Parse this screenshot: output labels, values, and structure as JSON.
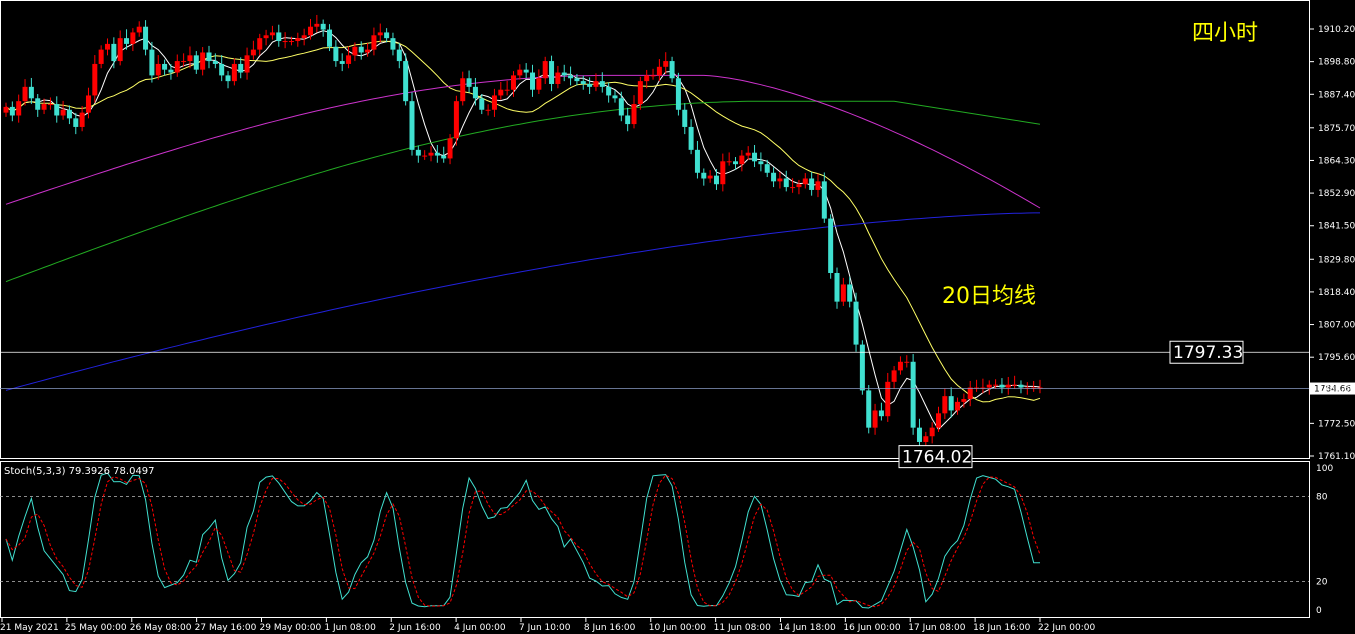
{
  "chart_data": {
    "type": "candlestick",
    "period_label": "四小时",
    "annotation": "20日均线",
    "price_axis": {
      "ticks": [
        "1910.20",
        "1898.80",
        "1887.40",
        "1875.70",
        "1864.30",
        "1852.90",
        "1841.50",
        "1829.80",
        "1818.40",
        "1807.00",
        "1795.60",
        "1784.66",
        "1772.50",
        "1761.10"
      ],
      "range": [
        1761.1,
        1910.2
      ]
    },
    "levels": {
      "resistance": {
        "label": "1797.33",
        "value": 1797.33,
        "color": "#ffffff"
      },
      "current": {
        "label": "1784.66",
        "value": 1784.66,
        "color": "#8a9bc4"
      },
      "low": {
        "label": "1764.02",
        "value": 1764.02,
        "color": "#ffffff"
      }
    },
    "x_axis": {
      "ticks": [
        "21 May 2021",
        "25 May 00:00",
        "26 May 08:00",
        "27 May 16:00",
        "29 May 00:00",
        "1 Jun 08:00",
        "2 Jun 16:00",
        "4 Jun 00:00",
        "7 Jun 10:00",
        "8 Jun 16:00",
        "10 Jun 00:00",
        "11 Jun 08:00",
        "14 Jun 18:00",
        "16 Jun 00:00",
        "17 Jun 08:00",
        "18 Jun 16:00",
        "22 Jun 00:00"
      ]
    },
    "colors": {
      "up": "#ff0000",
      "down": "#40e0d0",
      "ma5": "#ffffff",
      "ma20": "#ffff66",
      "ma60": "#22aa22",
      "ma120": "#cc33cc",
      "ma240": "#2222dd"
    },
    "candles_close": [
      1883,
      1880,
      1885,
      1890,
      1886,
      1882,
      1884,
      1884,
      1880,
      1882,
      1879,
      1876,
      1881,
      1887,
      1898,
      1903,
      1905,
      1899,
      1907,
      1905,
      1909,
      1911,
      1903,
      1894,
      1898,
      1896,
      1895,
      1899,
      1899,
      1901,
      1896,
      1902,
      1899,
      1898,
      1894,
      1892,
      1898,
      1895,
      1901,
      1903,
      1907,
      1908,
      1909,
      1906,
      1906,
      1906,
      1907,
      1908,
      1911,
      1912,
      1910,
      1904,
      1899,
      1898,
      1901,
      1904,
      1902,
      1903,
      1908,
      1909,
      1907,
      1903,
      1899,
      1885,
      1868,
      1866,
      1866,
      1867,
      1866,
      1865,
      1872,
      1885,
      1893,
      1890,
      1886,
      1882,
      1882,
      1887,
      1889,
      1889,
      1894,
      1896,
      1895,
      1889,
      1893,
      1899,
      1891,
      1895,
      1894,
      1893,
      1892,
      1891,
      1890,
      1892,
      1890,
      1887,
      1886,
      1880,
      1877,
      1884,
      1892,
      1894,
      1894,
      1897,
      1899,
      1893,
      1882,
      1876,
      1868,
      1860,
      1858,
      1859,
      1856,
      1864,
      1864,
      1863,
      1866,
      1867,
      1864,
      1863,
      1860,
      1857,
      1858,
      1855,
      1855,
      1856,
      1858,
      1854,
      1857,
      1844,
      1825,
      1815,
      1821,
      1815,
      1800,
      1784,
      1771,
      1777,
      1775,
      1787,
      1791,
      1794,
      1794,
      1771,
      1766,
      1768,
      1771,
      1776,
      1782,
      1777,
      1780,
      1781,
      1785,
      1785,
      1785,
      1786,
      1786,
      1785,
      1786,
      1786,
      1785,
      1785,
      1785,
      1785
    ],
    "stoch": {
      "title": "Stoch(5,3,3) 79.3926 78.0497",
      "levels": [
        20,
        80
      ],
      "axis_ticks": [
        "100",
        "80",
        "20",
        "0"
      ],
      "k_color": "#40e0d0",
      "d_color": "#ff0000"
    }
  }
}
